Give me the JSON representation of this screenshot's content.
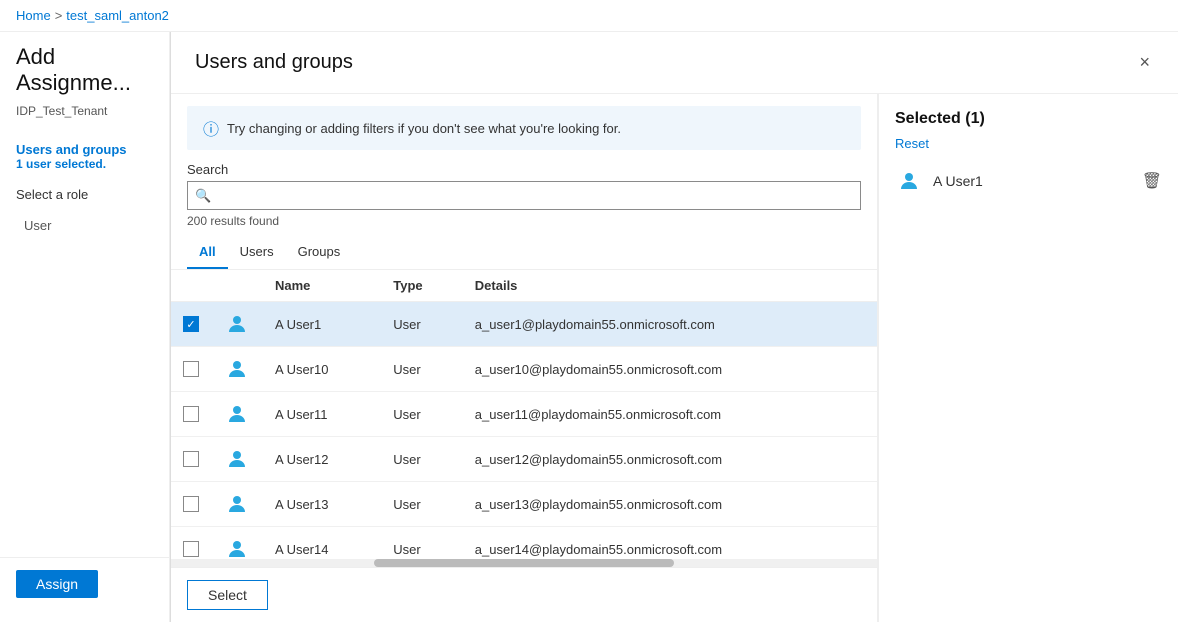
{
  "breadcrumb": {
    "home": "Home",
    "separator": ">",
    "current": "test_saml_anton2"
  },
  "sidebar": {
    "title": "Add Assignme...",
    "subtitle": "IDP_Test_Tenant",
    "nav": [
      {
        "id": "users-groups",
        "label": "Users and groups",
        "active": true,
        "badge": "1 user selected."
      },
      {
        "id": "select-role",
        "label": "Select a role",
        "active": false,
        "badge": null
      },
      {
        "id": "user",
        "label": "User",
        "active": false,
        "badge": null,
        "sub": true
      }
    ],
    "assign_label": "Assign"
  },
  "modal": {
    "title": "Users and groups",
    "close_label": "×",
    "info_banner": "Try changing or adding filters if you don't see what you're looking for.",
    "search": {
      "label": "Search",
      "placeholder": "",
      "results_count": "200 results found"
    },
    "tabs": [
      {
        "id": "all",
        "label": "All",
        "active": true
      },
      {
        "id": "users",
        "label": "Users",
        "active": false
      },
      {
        "id": "groups",
        "label": "Groups",
        "active": false
      }
    ],
    "table": {
      "columns": [
        {
          "id": "check",
          "label": ""
        },
        {
          "id": "avatar",
          "label": ""
        },
        {
          "id": "name",
          "label": "Name"
        },
        {
          "id": "type",
          "label": "Type"
        },
        {
          "id": "details",
          "label": "Details"
        }
      ],
      "rows": [
        {
          "id": 1,
          "name": "A User1",
          "type": "User",
          "details": "a_user1@playdomain55.onmicrosoft.com",
          "checked": true
        },
        {
          "id": 2,
          "name": "A User10",
          "type": "User",
          "details": "a_user10@playdomain55.onmicrosoft.com",
          "checked": false
        },
        {
          "id": 3,
          "name": "A User11",
          "type": "User",
          "details": "a_user11@playdomain55.onmicrosoft.com",
          "checked": false
        },
        {
          "id": 4,
          "name": "A User12",
          "type": "User",
          "details": "a_user12@playdomain55.onmicrosoft.com",
          "checked": false
        },
        {
          "id": 5,
          "name": "A User13",
          "type": "User",
          "details": "a_user13@playdomain55.onmicrosoft.com",
          "checked": false
        },
        {
          "id": 6,
          "name": "A User14",
          "type": "User",
          "details": "a_user14@playdomain55.onmicrosoft.com",
          "checked": false
        }
      ]
    },
    "select_label": "Select"
  },
  "selected_panel": {
    "header": "Selected (1)",
    "reset_label": "Reset",
    "users": [
      {
        "name": "A User1"
      }
    ]
  },
  "colors": {
    "accent": "#0078d4",
    "selected_row_bg": "#deecf9",
    "info_banner_bg": "#eff6fc"
  }
}
